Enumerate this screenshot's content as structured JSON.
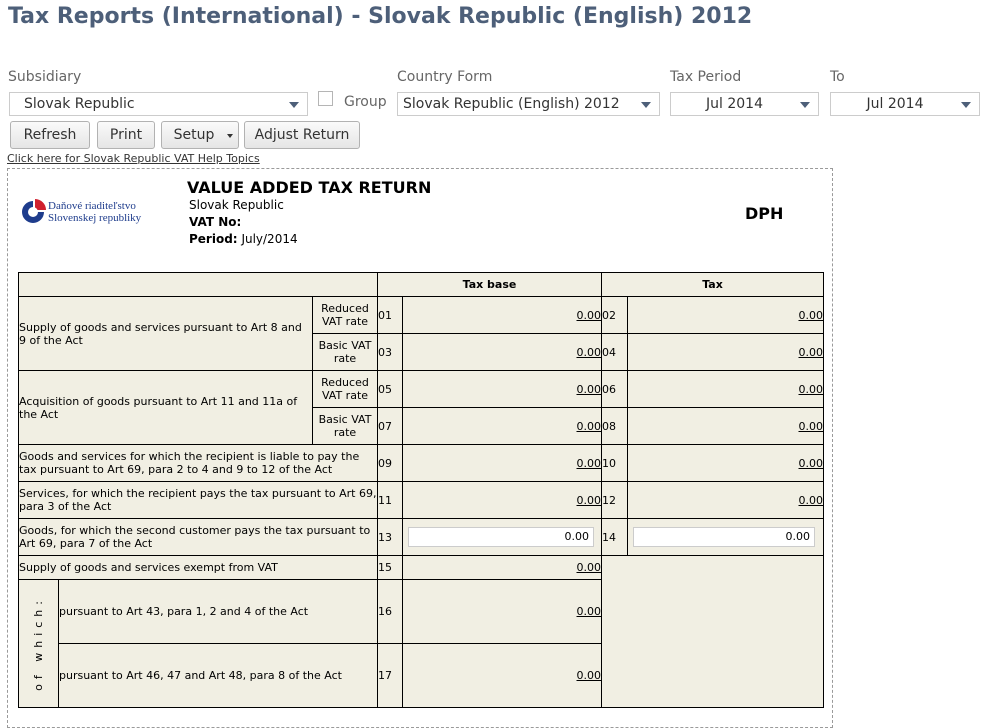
{
  "page": {
    "title": "Tax Reports (International) - Slovak Republic (English) 2012"
  },
  "filters": {
    "subsidiary_label": "Subsidiary",
    "subsidiary_value": "Slovak Republic",
    "group_label": "Group",
    "country_form_label": "Country Form",
    "country_form_value": "Slovak Republic (English) 2012",
    "tax_period_label": "Tax Period",
    "tax_period_value": "Jul 2014",
    "to_label": "To",
    "to_value": "Jul 2014"
  },
  "toolbar": {
    "refresh_label": "Refresh",
    "print_label": "Print",
    "setup_label": "Setup",
    "adjust_label": "Adjust Return"
  },
  "help_link": "Click here for Slovak Republic VAT Help Topics",
  "report": {
    "logo_line1": "Daňové riaditeľstvo",
    "logo_line2": "Slovenskej republiky",
    "title": "VALUE ADDED TAX RETURN",
    "company": "Slovak Republic",
    "vat_no_label": "VAT No:",
    "period_label": "Period:",
    "period_value": "July/2014",
    "form_code": "DPH"
  },
  "table": {
    "header_tax_base": "Tax base",
    "header_tax": "Tax",
    "reduced_rate": "Reduced VAT rate",
    "basic_rate": "Basic VAT rate",
    "row_supply": "Supply of goods and services pursuant to Art 8 and 9 of the Act",
    "row_acquisition": "Acquisition of goods pursuant to Art 11 and 11a of the Act",
    "row_recipient_liable": "Goods and services for which the recipient is liable to pay the tax pursuant to Art 69, para 2 to 4 and 9 to 12 of the Act",
    "row_services_recipient": "Services, for which the recipient pays the tax pursuant to Art 69, para 3 of the Act",
    "row_second_customer": "Goods, for which the second customer pays the tax pursuant to Art 69, para 7 of the Act",
    "row_exempt": "Supply of goods and services exempt from VAT",
    "of_which": "of which:",
    "row_art43": "pursuant to Art 43, para 1, 2 and 4 of the Act",
    "row_art46": "pursuant to Art 46, 47 and Art 48, para 8 of the Act",
    "codes": {
      "c01": "01",
      "c02": "02",
      "c03": "03",
      "c04": "04",
      "c05": "05",
      "c06": "06",
      "c07": "07",
      "c08": "08",
      "c09": "09",
      "c10": "10",
      "c11": "11",
      "c12": "12",
      "c13": "13",
      "c14": "14",
      "c15": "15",
      "c16": "16",
      "c17": "17"
    },
    "values": {
      "v01": "0.00",
      "v02": "0.00",
      "v03": "0.00",
      "v04": "0.00",
      "v05": "0.00",
      "v06": "0.00",
      "v07": "0.00",
      "v08": "0.00",
      "v09": "0.00",
      "v10": "0.00",
      "v11": "0.00",
      "v12": "0.00",
      "v13": "0.00",
      "v14": "0.00",
      "v15": "0.00",
      "v16": "0.00",
      "v17": "0.00"
    }
  }
}
